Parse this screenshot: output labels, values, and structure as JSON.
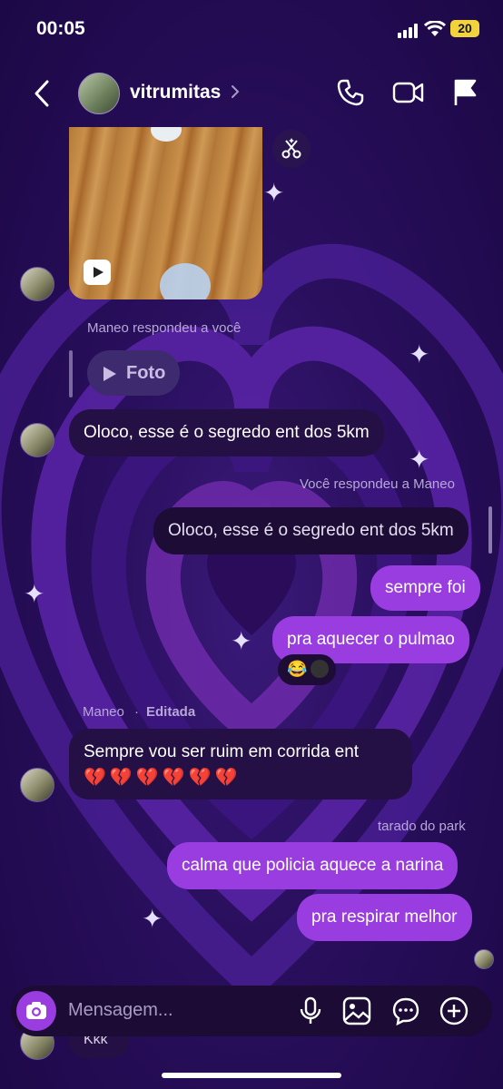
{
  "status": {
    "time": "00:05",
    "battery": "20"
  },
  "header": {
    "username": "vitrumitas"
  },
  "messages": {
    "reply_meta_1": "Maneo respondeu a você",
    "foto_label": "Foto",
    "msg_in_1": "Oloco, esse é o segredo ent dos 5km",
    "reply_meta_2": "Você respondeu a Maneo",
    "msg_quoted": "Oloco, esse é o segredo ent dos 5km",
    "msg_out_1": "sempre foi",
    "msg_out_2": "pra aquecer o pulmao",
    "reaction_1": "😂",
    "sender_name": "Maneo",
    "sender_dot": "·",
    "edited_label": "Editada",
    "msg_in_2": "Sempre vou ser ruim em corrida ent",
    "msg_in_2_emojis": "💔💔💔💔💔💔",
    "reply_meta_3": "tarado do park",
    "msg_out_3": "calma que policia aquece a narina",
    "msg_out_4": "pra respirar melhor",
    "partial_msg": "Kkk"
  },
  "composer": {
    "placeholder": "Mensagem..."
  },
  "colors": {
    "accent": "#9a3de0",
    "incoming_bubble": "#241044",
    "background": "#2a0f5e"
  },
  "icons": [
    "back-arrow-icon",
    "chevron-right-icon",
    "phone-icon",
    "video-camera-icon",
    "flag-icon",
    "scissors-sparkle-icon",
    "play-icon",
    "camera-icon",
    "microphone-icon",
    "image-icon",
    "sticker-chat-icon",
    "plus-circle-icon"
  ]
}
